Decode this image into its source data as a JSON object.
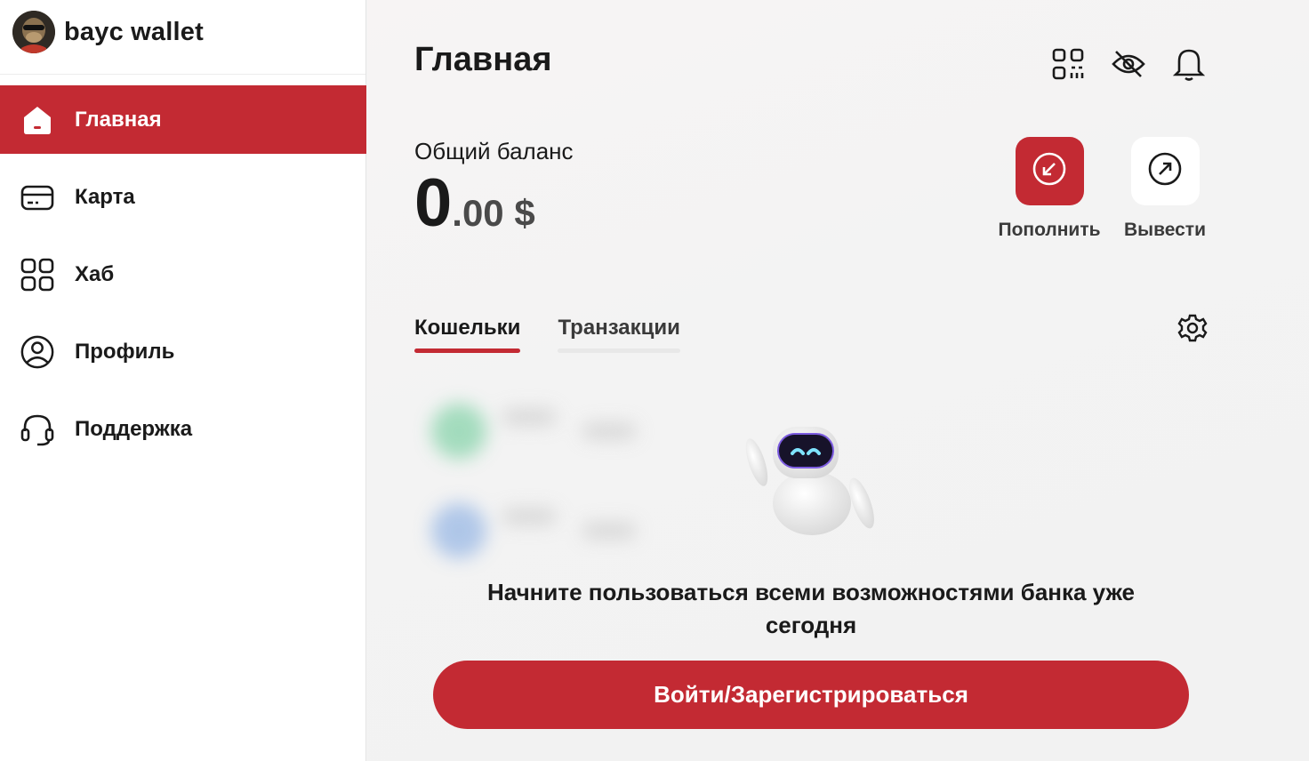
{
  "brand": {
    "name": "bayc wallet"
  },
  "sidebar": {
    "items": [
      {
        "label": "Главная",
        "icon": "home-icon",
        "active": true
      },
      {
        "label": "Карта",
        "icon": "card-icon",
        "active": false
      },
      {
        "label": "Хаб",
        "icon": "grid-icon",
        "active": false
      },
      {
        "label": "Профиль",
        "icon": "profile-icon",
        "active": false
      },
      {
        "label": "Поддержка",
        "icon": "headset-icon",
        "active": false
      }
    ]
  },
  "header": {
    "title": "Главная",
    "icons": [
      "qr-code-icon",
      "eye-off-icon",
      "bell-icon"
    ]
  },
  "balance": {
    "label": "Общий баланс",
    "integer": "0",
    "decimal": ".00 $"
  },
  "actions": {
    "topup_label": "Пополнить",
    "withdraw_label": "Вывести"
  },
  "tabs": [
    {
      "label": "Кошельки",
      "active": true
    },
    {
      "label": "Транзакции",
      "active": false
    }
  ],
  "cta": {
    "text": "Начните пользоваться всеми возможностями банка уже сегодня",
    "button_label": "Войти/Зарегистрироваться"
  },
  "colors": {
    "accent": "#c32a33",
    "text": "#1a1a1a",
    "background": "#f4f4f4"
  }
}
